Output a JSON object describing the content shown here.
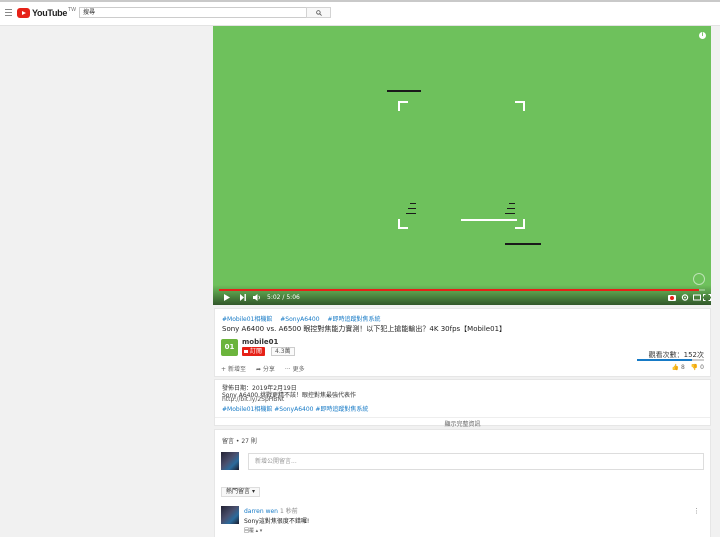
{
  "header": {
    "logo_text": "YouTube",
    "logo_region": "TW",
    "search_value": "搜尋"
  },
  "player": {
    "time_current": "5:02",
    "time_separator": "/",
    "time_total": "5:06",
    "progress": 0.987,
    "info_label": "i",
    "colors": {
      "screen": "#6ec15c",
      "accent": "#e62117"
    }
  },
  "video": {
    "hashtags": [
      "#Mobile01相機館",
      "#SonyA6400",
      "#即時追蹤對焦系統"
    ],
    "title": "Sony A6400 vs. A6500 眼控對焦能力實測！以下犯上搶能輸出？4K 30fps【Mobile01】",
    "channel_logo": "01",
    "channel_name": "mobile01",
    "subscribe_label": "訂閱",
    "subscriber_count": "4.3萬",
    "views": "觀看次數：152次",
    "like_ratio": 0.82,
    "actions": [
      "新增至",
      "分享",
      "更多"
    ],
    "likes": "8",
    "dislikes": "0"
  },
  "description": {
    "lines": [
      "發佈日期：2019年2月19日",
      "Sony A6400 挑戰更精不該！眼控對焦最強代表作",
      "http://bit.ly/2SpHBNt"
    ],
    "tags_line": "#Mobile01相機館 #SonyA6400 #即時追蹤對焦系統",
    "show_more": "顯示完整資訊"
  },
  "comments": {
    "count_label": "留言 • 27 則",
    "input_placeholder": "新增公開留言...",
    "sort_label": "熱門留言",
    "items": [
      {
        "author": "darren wen",
        "time": "1 秒前",
        "text": "Sony這對焦很度不錯囉!",
        "reply_label": "回覆"
      }
    ]
  }
}
